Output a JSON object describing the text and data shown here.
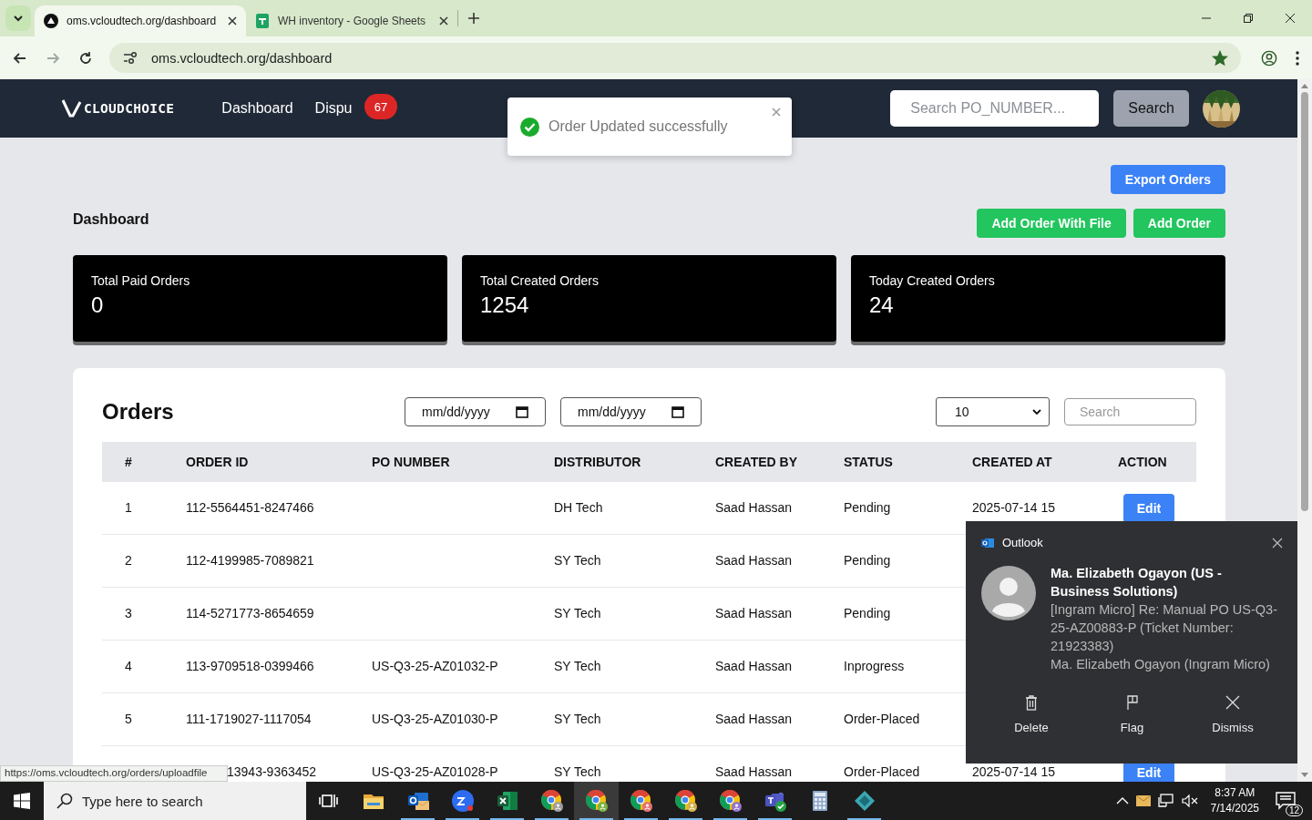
{
  "browser": {
    "tabs": [
      {
        "title": "oms.vcloudtech.org/dashboard",
        "kind": "site",
        "selected": true
      },
      {
        "title": "WH inventory - Google Sheets",
        "kind": "sheets",
        "selected": false
      }
    ],
    "nav_buttons": [
      {
        "kind": "back",
        "disabled": false
      },
      {
        "kind": "forward",
        "disabled": true
      },
      {
        "kind": "reload",
        "disabled": false
      }
    ],
    "url": "oms.vcloudtech.org/dashboard",
    "bookmarked": true
  },
  "header": {
    "logo": "CLOUDCHOICE",
    "links": [
      "Dashboard",
      "Dispu"
    ],
    "badge": "67",
    "search_placeholder": "Search PO_NUMBER...",
    "search_button": "Search"
  },
  "toast": {
    "message": "Order Updated successfully"
  },
  "page": {
    "title": "Dashboard",
    "export_button": "Export Orders",
    "buttons": [
      "Add Order With File",
      "Add Order"
    ]
  },
  "stats": [
    {
      "label": "Total Paid Orders",
      "value": "0"
    },
    {
      "label": "Total Created Orders",
      "value": "1254"
    },
    {
      "label": "Today Created Orders",
      "value": "24"
    }
  ],
  "orders": {
    "title": "Orders",
    "date_placeholders": [
      "mm/dd/yyyy",
      "mm/dd/yyyy"
    ],
    "page_size": "10",
    "search_placeholder": "Search",
    "columns": [
      "#",
      "ORDER ID",
      "PO NUMBER",
      "DISTRIBUTOR",
      "CREATED BY",
      "STATUS",
      "CREATED AT",
      "ACTION"
    ],
    "rows": [
      {
        "num": "1",
        "order_id": "112-5564451-8247466",
        "distributor": "DH Tech",
        "created_by": "Saad Hassan",
        "status": "Pending",
        "created_at": "2025-07-14 15",
        "action": "Edit"
      },
      {
        "num": "2",
        "order_id": "112-4199985-7089821",
        "distributor": "SY Tech",
        "created_by": "Saad Hassan",
        "status": "Pending"
      },
      {
        "num": "3",
        "order_id": "114-5271773-8654659",
        "distributor": "SY Tech",
        "created_by": "Saad Hassan",
        "status": "Pending"
      },
      {
        "num": "4",
        "order_id": "113-9709518-0399466",
        "po_number": "US-Q3-25-AZ01032-P",
        "distributor": "SY Tech",
        "created_by": "Saad Hassan",
        "status": "Inprogress"
      },
      {
        "num": "5",
        "order_id": "111-1719027-1117054",
        "po_number": "US-Q3-25-AZ01030-P",
        "distributor": "SY Tech",
        "created_by": "Saad Hassan",
        "status": "Order-Placed"
      },
      {
        "order_id": "13943-9363452",
        "po_number": "US-Q3-25-AZ01028-P",
        "distributor": "SY Tech",
        "created_by": "Saad Hassan",
        "status": "Order-Placed",
        "created_at": "2025-07-14 15",
        "action": "Edit"
      }
    ]
  },
  "status_url": "https://oms.vcloudtech.org/orders/uploadfile",
  "notification": {
    "app": "Outlook",
    "sender": "Ma. Elizabeth Ogayon (US - Business Solutions)",
    "subject": "[Ingram Micro] Re: Manual PO US-Q3-25-AZ00883-P (Ticket Number: 21923383)",
    "from": "Ma. Elizabeth Ogayon (Ingram Micro)",
    "actions": [
      {
        "label": "Delete",
        "kind": "delete"
      },
      {
        "label": "Flag",
        "kind": "flag"
      },
      {
        "label": "Dismiss",
        "kind": "dismiss"
      }
    ]
  },
  "taskbar": {
    "search_placeholder": "Type here to search",
    "apps": [
      {
        "kind": "taskview",
        "running": false,
        "selected": false
      },
      {
        "kind": "folder",
        "running": false,
        "selected": false
      },
      {
        "kind": "mail",
        "running": true,
        "selected": false
      },
      {
        "kind": "video",
        "running": true,
        "selected": false
      },
      {
        "kind": "sheet",
        "running": true,
        "selected": false
      },
      {
        "kind": "browser",
        "color": "#9e9e9e",
        "running": true,
        "selected": false
      },
      {
        "kind": "browser",
        "color": "#7cb342",
        "running": true,
        "selected": true
      },
      {
        "kind": "browser",
        "color": "#e57373",
        "running": true,
        "selected": false
      },
      {
        "kind": "browser",
        "color": "#d4b24a",
        "running": true,
        "selected": false
      },
      {
        "kind": "browser",
        "color": "#9575cd",
        "running": true,
        "selected": false
      },
      {
        "kind": "chat",
        "running": true,
        "selected": false
      },
      {
        "kind": "calculator",
        "running": false,
        "selected": false
      },
      {
        "kind": "diamond",
        "running": true,
        "selected": false
      }
    ],
    "time": "8:37 AM",
    "date": "7/14/2025",
    "notification_count": "12"
  }
}
